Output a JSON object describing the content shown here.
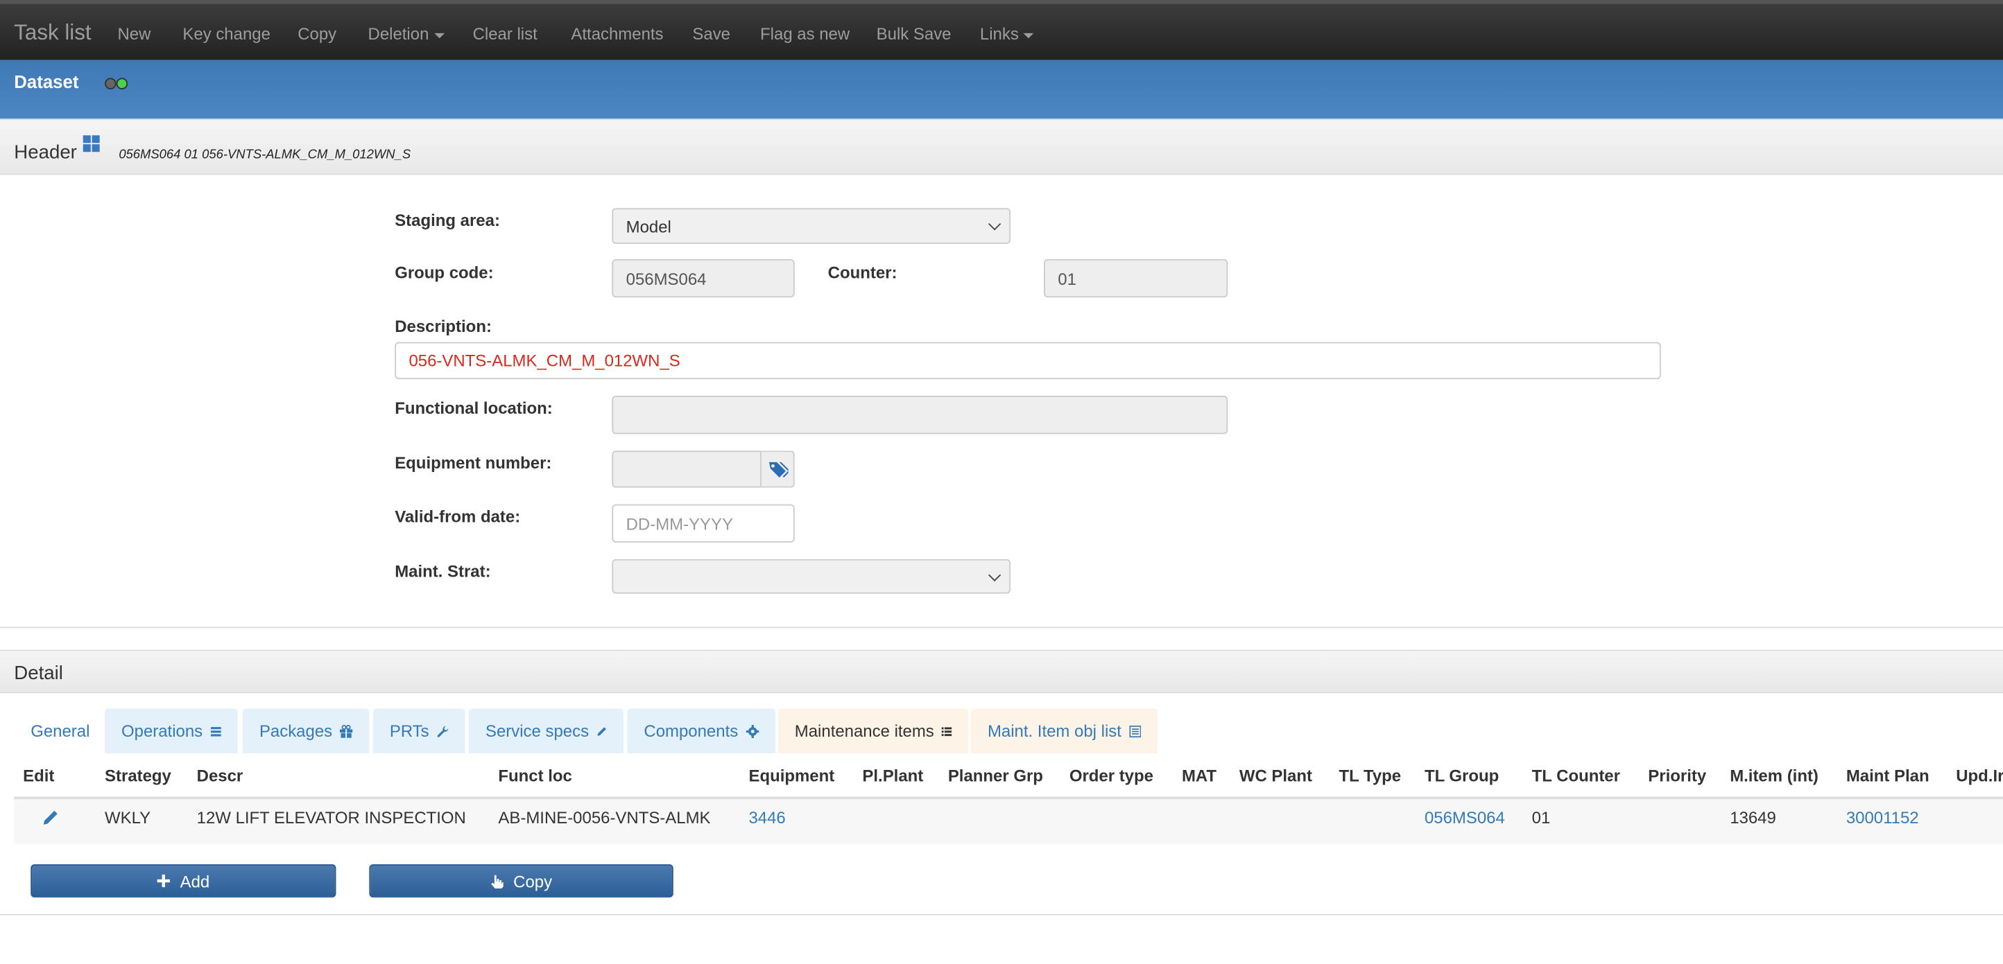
{
  "navbar": {
    "brand": "Task list",
    "items": [
      "New",
      "Key change",
      "Copy",
      "Deletion",
      "Clear list",
      "Attachments",
      "Save",
      "Flag as new",
      "Bulk Save",
      "Links"
    ]
  },
  "dataset": {
    "title": "Dataset",
    "status_colors": [
      "#444444",
      "#3cba3c"
    ]
  },
  "header": {
    "title": "Header",
    "subtitle": "056MS064 01 056-VNTS-ALMK_CM_M_012WN_S"
  },
  "form": {
    "staging_area": {
      "label": "Staging area:",
      "value": "Model"
    },
    "group_code": {
      "label": "Group code:",
      "value": "056MS064"
    },
    "counter": {
      "label": "Counter:",
      "value": "01"
    },
    "description": {
      "label": "Description:",
      "value": "056-VNTS-ALMK_CM_M_012WN_S"
    },
    "functional_location": {
      "label": "Functional location:",
      "value": ""
    },
    "equipment_number": {
      "label": "Equipment number:",
      "value": ""
    },
    "valid_from": {
      "label": "Valid-from date:",
      "placeholder": "DD-MM-YYYY"
    },
    "maint_strat": {
      "label": "Maint. Strat:",
      "value": ""
    }
  },
  "detail": {
    "title": "Detail",
    "tabs": [
      "General",
      "Operations",
      "Packages",
      "PRTs",
      "Service specs",
      "Components",
      "Maintenance items",
      "Maint. Item obj list"
    ],
    "columns": [
      "Edit",
      "Strategy",
      "Descr",
      "Funct loc",
      "Equipment",
      "Pl.Plant",
      "Planner Grp",
      "Order type",
      "MAT",
      "WC Plant",
      "TL Type",
      "TL Group",
      "TL Counter",
      "Priority",
      "M.item (int)",
      "Maint Plan",
      "Upd.Ir"
    ],
    "row": {
      "strategy": "WKLY",
      "descr": "12W LIFT ELEVATOR INSPECTION",
      "funct_loc": "AB-MINE-0056-VNTS-ALMK",
      "equipment": "3446",
      "tl_group": "056MS064",
      "tl_counter": "01",
      "m_item": "13649",
      "maint_plan": "30001152"
    },
    "buttons": {
      "add": "Add",
      "copy": "Copy"
    }
  },
  "colors": {
    "accent": "#337ab7",
    "dataset_bar": "#4a83c0",
    "description_text": "#d9291c"
  }
}
